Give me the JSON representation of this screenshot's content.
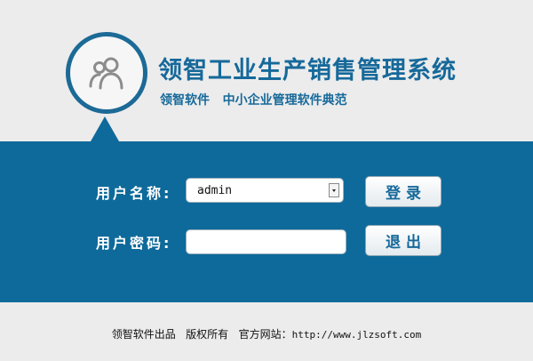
{
  "header": {
    "title": "领智工业生产销售管理系统",
    "subtitle": "领智软件   中小企业管理软件典范",
    "logo_icon": "users-icon"
  },
  "form": {
    "username_label": "用户名称:",
    "username_value": "admin",
    "password_label": "用户密码:",
    "password_value": "",
    "login_button": "登录",
    "exit_button": "退出"
  },
  "footer": {
    "text": "领智软件出品   版权所有   官方网站：",
    "url": "http://www.jlzsoft.com"
  },
  "colors": {
    "brand_blue": "#0e6a9a",
    "title_blue": "#16699a",
    "background": "#ececec"
  }
}
